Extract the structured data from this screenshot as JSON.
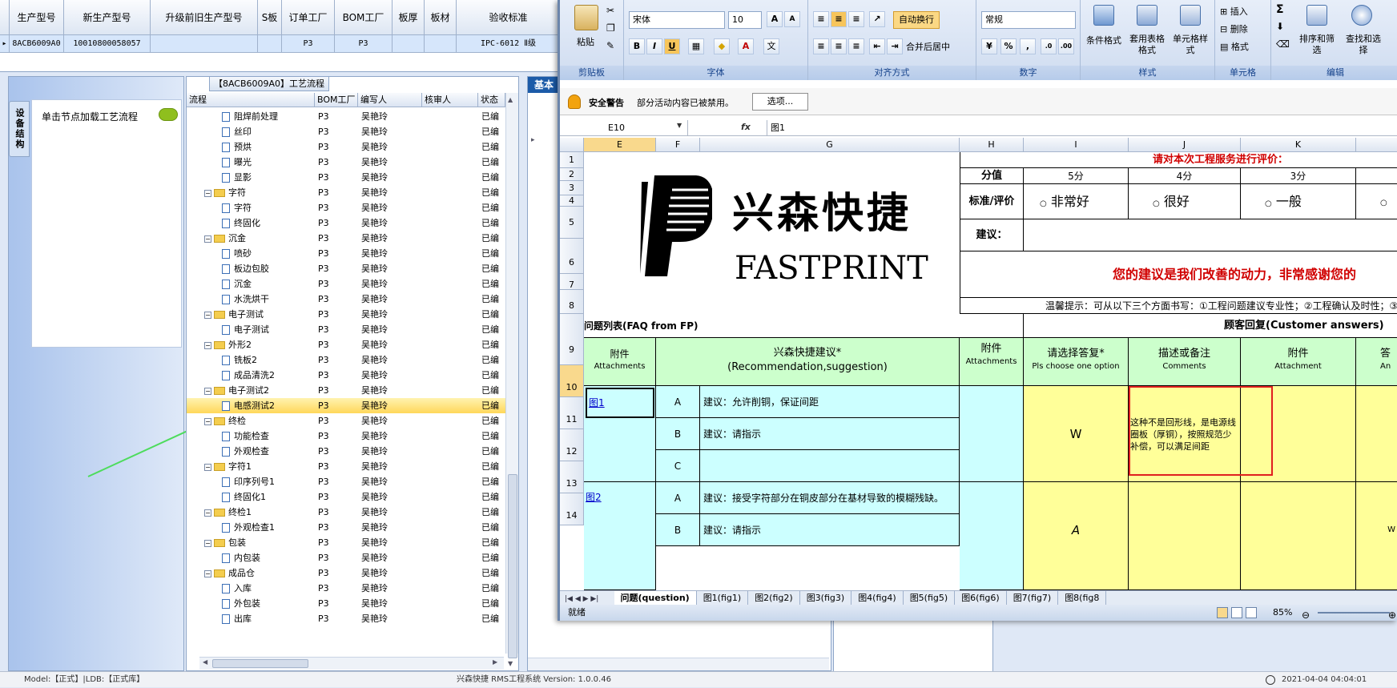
{
  "top_grid": {
    "headers": [
      "生产型号",
      "新生产型号",
      "升级前旧生产型号",
      "S板",
      "订单工厂",
      "BOM工厂",
      "板厚",
      "板材",
      "验收标准"
    ],
    "row": [
      "8ACB6009A0",
      "10010800058057",
      "",
      "",
      "P3",
      "P3",
      "",
      "",
      "IPC-6012 Ⅱ级"
    ]
  },
  "left_panel": {
    "tab_label": "设备结构",
    "item": "单击节点加载工艺流程"
  },
  "tree": {
    "title": "【8ACB6009A0】工艺流程",
    "columns": [
      "流程",
      "BOM工厂",
      "编写人",
      "核审人",
      "状态"
    ],
    "rows": [
      {
        "name": "阻焊前处理",
        "type": "leaf",
        "bom": "P3",
        "author": "吴艳玲",
        "status": "已编"
      },
      {
        "name": "丝印",
        "type": "leaf",
        "bom": "P3",
        "author": "吴艳玲",
        "status": "已编"
      },
      {
        "name": "预烘",
        "type": "leaf",
        "bom": "P3",
        "author": "吴艳玲",
        "status": "已编"
      },
      {
        "name": "曝光",
        "type": "leaf",
        "bom": "P3",
        "author": "吴艳玲",
        "status": "已编"
      },
      {
        "name": "显影",
        "type": "leaf",
        "bom": "P3",
        "author": "吴艳玲",
        "status": "已编"
      },
      {
        "name": "字符",
        "type": "folder",
        "bom": "P3",
        "author": "吴艳玲",
        "status": "已编"
      },
      {
        "name": "字符",
        "type": "leaf",
        "bom": "P3",
        "author": "吴艳玲",
        "status": "已编"
      },
      {
        "name": "终固化",
        "type": "leaf",
        "bom": "P3",
        "author": "吴艳玲",
        "status": "已编"
      },
      {
        "name": "沉金",
        "type": "folder",
        "bom": "P3",
        "author": "吴艳玲",
        "status": "已编"
      },
      {
        "name": "喷砂",
        "type": "leaf",
        "bom": "P3",
        "author": "吴艳玲",
        "status": "已编"
      },
      {
        "name": "板边包胶",
        "type": "leaf",
        "bom": "P3",
        "author": "吴艳玲",
        "status": "已编"
      },
      {
        "name": "沉金",
        "type": "leaf",
        "bom": "P3",
        "author": "吴艳玲",
        "status": "已编"
      },
      {
        "name": "水洗烘干",
        "type": "leaf",
        "bom": "P3",
        "author": "吴艳玲",
        "status": "已编"
      },
      {
        "name": "电子测试",
        "type": "folder",
        "bom": "P3",
        "author": "吴艳玲",
        "status": "已编"
      },
      {
        "name": "电子测试",
        "type": "leaf",
        "bom": "P3",
        "author": "吴艳玲",
        "status": "已编"
      },
      {
        "name": "外形2",
        "type": "folder",
        "bom": "P3",
        "author": "吴艳玲",
        "status": "已编"
      },
      {
        "name": "铣板2",
        "type": "leaf",
        "bom": "P3",
        "author": "吴艳玲",
        "status": "已编"
      },
      {
        "name": "成品清洗2",
        "type": "leaf",
        "bom": "P3",
        "author": "吴艳玲",
        "status": "已编"
      },
      {
        "name": "电子测试2",
        "type": "folder",
        "bom": "P3",
        "author": "吴艳玲",
        "status": "已编"
      },
      {
        "name": "电感测试2",
        "type": "leaf",
        "bom": "P3",
        "author": "吴艳玲",
        "status": "已编",
        "selected": true
      },
      {
        "name": "终检",
        "type": "folder",
        "bom": "P3",
        "author": "吴艳玲",
        "status": "已编"
      },
      {
        "name": "功能检查",
        "type": "leaf",
        "bom": "P3",
        "author": "吴艳玲",
        "status": "已编"
      },
      {
        "name": "外观检查",
        "type": "leaf",
        "bom": "P3",
        "author": "吴艳玲",
        "status": "已编"
      },
      {
        "name": "字符1",
        "type": "folder",
        "bom": "P3",
        "author": "吴艳玲",
        "status": "已编"
      },
      {
        "name": "印序列号1",
        "type": "leaf",
        "bom": "P3",
        "author": "吴艳玲",
        "status": "已编"
      },
      {
        "name": "终固化1",
        "type": "leaf",
        "bom": "P3",
        "author": "吴艳玲",
        "status": "已编"
      },
      {
        "name": "终检1",
        "type": "folder",
        "bom": "P3",
        "author": "吴艳玲",
        "status": "已编"
      },
      {
        "name": "外观检查1",
        "type": "leaf",
        "bom": "P3",
        "author": "吴艳玲",
        "status": "已编"
      },
      {
        "name": "包装",
        "type": "folder",
        "bom": "P3",
        "author": "吴艳玲",
        "status": "已编"
      },
      {
        "name": "内包装",
        "type": "leaf",
        "bom": "P3",
        "author": "吴艳玲",
        "status": "已编"
      },
      {
        "name": "成品仓",
        "type": "folder",
        "bom": "P3",
        "author": "吴艳玲",
        "status": "已编"
      },
      {
        "name": "入库",
        "type": "leaf",
        "bom": "P3",
        "author": "吴艳玲",
        "status": "已编"
      },
      {
        "name": "外包装",
        "type": "leaf",
        "bom": "P3",
        "author": "吴艳玲",
        "status": "已编"
      },
      {
        "name": "出库",
        "type": "leaf",
        "bom": "P3",
        "author": "吴艳玲",
        "status": "已编"
      }
    ]
  },
  "mid_panel": {
    "tab": "基本"
  },
  "excel": {
    "ribbon": {
      "clipboard": {
        "paste": "粘贴",
        "label": "剪贴板"
      },
      "font": {
        "name": "宋体",
        "size": "10",
        "label": "字体"
      },
      "alignment": {
        "wrap": "自动换行",
        "merge": "合并后居中",
        "label": "对齐方式"
      },
      "number": {
        "format": "常规",
        "label": "数字"
      },
      "styles": {
        "conditional": "条件格式",
        "table": "套用表格格式",
        "cell": "单元格样式",
        "label": "样式"
      },
      "cells": {
        "insert": "插入",
        "delete": "删除",
        "format": "格式",
        "label": "单元格"
      },
      "editing": {
        "sort": "排序和筛选",
        "find": "查找和选择",
        "label": "编辑"
      }
    },
    "security": {
      "title": "安全警告",
      "message": "部分活动内容已被禁用。",
      "button": "选项..."
    },
    "formula_bar": {
      "name_box": "E10",
      "fx": "fx",
      "value": "图1"
    },
    "columns": [
      "E",
      "F",
      "G",
      "H",
      "I",
      "J",
      "K"
    ],
    "rows": [
      "1",
      "2",
      "3",
      "4",
      "5",
      "6",
      "7",
      "8",
      "9",
      "10",
      "11",
      "12",
      "13",
      "14"
    ],
    "sheet": {
      "logo_cn": "兴森快捷",
      "logo_en": "FASTPRINT",
      "rate_title": "请对本次工程服务进行评价：",
      "score_label": "分值",
      "scores": [
        "5分",
        "4分",
        "3分"
      ],
      "std_label": "标准/评价",
      "ratings": [
        "非常好",
        "很好",
        "一般"
      ],
      "suggest_label": "建议：",
      "thanks": "您的建议是我们改善的动力，非常感谢您的",
      "tip": "温馨提示：可从以下三个方面书写：①工程问题建议专业性；②工程确认及时性；③",
      "faq": "问题列表(FAQ from FP)",
      "customer": "顾客回复(Customer answers)",
      "h_attach": "附件",
      "h_attach_en": "Attachments",
      "h_reco": "兴森快捷建议*",
      "h_reco_en": "(Recommendation,suggestion)",
      "h_attach2": "附件",
      "h_attach2_en": "Attachments",
      "h_choose": "请选择答复*",
      "h_choose_en": "Pls choose one option",
      "h_comment": "描述或备注",
      "h_comment_en": "Comments",
      "h_attach3": "附件",
      "h_attach3_en": "Attachment",
      "h_ans": "答",
      "h_ans_en": "An",
      "fig1": "图1",
      "fig2": "图2",
      "opt_a": "A",
      "opt_b": "B",
      "opt_c": "C",
      "sug_a1": "建议：允许削铜，保证间距",
      "sug_b1": "建议：请指示",
      "sug_a2": "建议：接受字符部分在铜皮部分在基材导致的模糊残缺。",
      "sug_b2": "建议：请指示",
      "answer1": "W",
      "answer2": "A",
      "comment1": "这种不是回形线，是电源线圈板（厚铜），按照规范少补偿，可以满足间距",
      "ans_partial": "W"
    },
    "tabs": [
      "问题(question)",
      "图1(fig1)",
      "图2(fig2)",
      "图3(fig3)",
      "图4(fig4)",
      "图5(fig5)",
      "图6(fig6)",
      "图7(fig7)",
      "图8(fig8"
    ],
    "status": {
      "ready": "就绪",
      "zoom": "85%"
    }
  },
  "app_status": {
    "left": "Model:【正式】|LDB:【正式库】",
    "center": "兴森快捷 RMS工程系统 Version: 1.0.0.46",
    "right": "2021-04-04 04:04:01"
  }
}
